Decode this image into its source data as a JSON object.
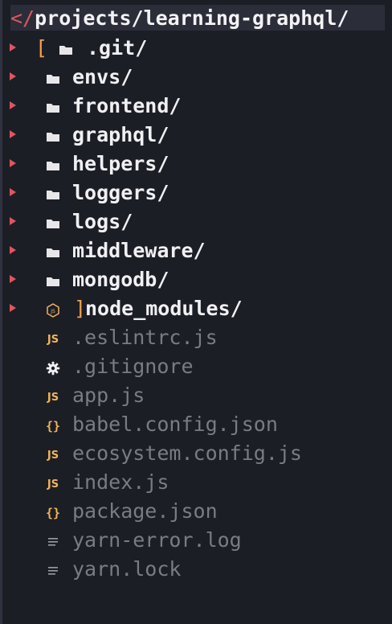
{
  "header": {
    "prefix": "</",
    "path": "projects/learning-graphql/"
  },
  "entries": [
    {
      "name": ".git/",
      "type": "folder",
      "icon": "folder-icon",
      "open_bracket": "["
    },
    {
      "name": "envs/",
      "type": "folder",
      "icon": "folder-icon"
    },
    {
      "name": "frontend/",
      "type": "folder",
      "icon": "folder-icon"
    },
    {
      "name": "graphql/",
      "type": "folder",
      "icon": "folder-icon"
    },
    {
      "name": "helpers/",
      "type": "folder",
      "icon": "folder-icon"
    },
    {
      "name": "loggers/",
      "type": "folder",
      "icon": "folder-icon"
    },
    {
      "name": "logs/",
      "type": "folder",
      "icon": "folder-icon"
    },
    {
      "name": "middleware/",
      "type": "folder",
      "icon": "folder-icon"
    },
    {
      "name": "mongodb/",
      "type": "folder",
      "icon": "folder-icon"
    },
    {
      "name": "node_modules/",
      "type": "folder",
      "icon": "nodejs-icon",
      "close_bracket": "]"
    },
    {
      "name": ".eslintrc.js",
      "type": "file",
      "icon": "js-icon"
    },
    {
      "name": ".gitignore",
      "type": "file",
      "icon": "gear-icon"
    },
    {
      "name": "app.js",
      "type": "file",
      "icon": "js-icon"
    },
    {
      "name": "babel.config.json",
      "type": "file",
      "icon": "json-icon"
    },
    {
      "name": "ecosystem.config.js",
      "type": "file",
      "icon": "js-icon"
    },
    {
      "name": "index.js",
      "type": "file",
      "icon": "js-icon"
    },
    {
      "name": "package.json",
      "type": "file",
      "icon": "json-icon"
    },
    {
      "name": "yarn-error.log",
      "type": "file",
      "icon": "text-file-icon"
    },
    {
      "name": "yarn.lock",
      "type": "file",
      "icon": "text-file-icon"
    }
  ],
  "icons": {
    "js_label": "JS",
    "json_label": "{}"
  },
  "colors": {
    "background": "#1c1e26",
    "header_bg": "#2b2d39",
    "accent_red": "#e05561",
    "icon_orange": "#f2b45a",
    "file_text": "#7a7b85",
    "folder_text": "#f0f0f3"
  }
}
